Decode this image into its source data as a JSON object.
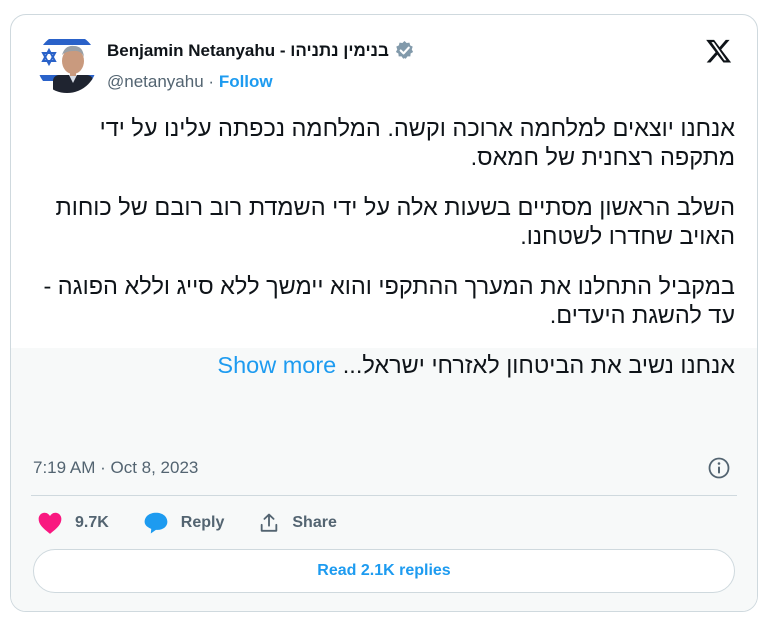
{
  "author": {
    "display_name": "Benjamin Netanyahu - בנימין נתניהו",
    "handle": "@netanyahu",
    "separator": "·",
    "follow_label": "Follow",
    "verified": true,
    "avatar_icon": "avatar-photo"
  },
  "brand": {
    "logo_icon": "x-logo-icon"
  },
  "tweet": {
    "paragraphs": [
      "אנחנו יוצאים למלחמה ארוכה וקשה. המלחמה נכפתה עלינו על ידי מתקפה רצחנית של חמאס.",
      "השלב הראשון מסתיים בשעות אלה על ידי השמדת רוב רובם של כוחות האויב שחדרו לשטחנו.",
      "במקביל התחלנו את המערך ההתקפי והוא יימשך ללא סייג וללא הפוגה - עד להשגת היעדים."
    ],
    "last_line": "אנחנו נשיב את הביטחון לאזרחי ישראל...",
    "show_more_label": "Show more",
    "timestamp": "7:19 AM · Oct 8, 2023"
  },
  "actions": {
    "likes_count": "9.7K",
    "reply_label": "Reply",
    "share_label": "Share"
  },
  "footer": {
    "read_replies_label": "Read 2.1K replies"
  },
  "colors": {
    "accent": "#1d9bf0",
    "like": "#f91880",
    "text": "#0f1419",
    "muted": "#536471",
    "border": "#cfd9de"
  }
}
